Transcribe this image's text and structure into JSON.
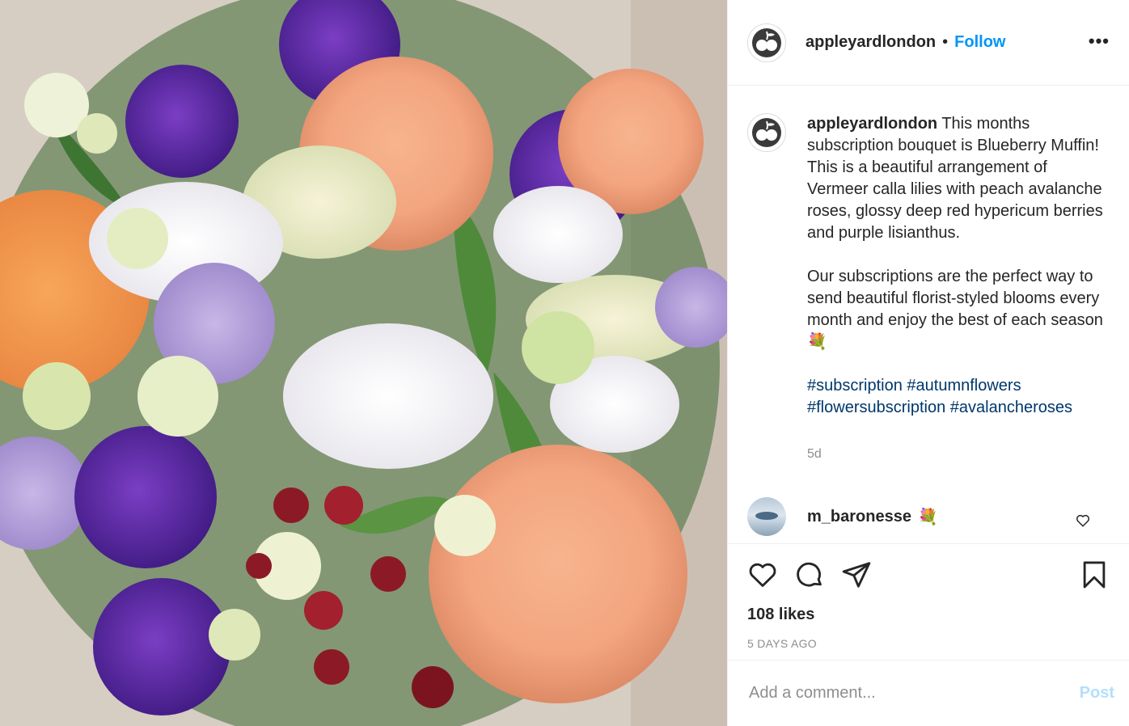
{
  "header": {
    "username": "appleyardlondon",
    "separator": "•",
    "follow_label": "Follow",
    "more_label": "•••"
  },
  "caption": {
    "username": "appleyardlondon",
    "text1": "This months subscription bouquet is Blueberry Muffin! This is a beautiful arrangement of Vermeer calla lilies with peach avalanche roses, glossy deep red hypericum berries and purple lisianthus.",
    "text2": "Our subscriptions are the perfect way to send beautiful florist-styled blooms every month and enjoy the best of each season",
    "text2_emoji": "💐",
    "hashtags": [
      "#subscription",
      "#autumnflowers",
      "#flowersubscription",
      "#avalancheroses"
    ],
    "age": "5d"
  },
  "comment": {
    "username": "m_baronesse",
    "emoji": "💐"
  },
  "actions": {
    "icons": [
      "heart-icon",
      "comment-icon",
      "share-icon",
      "bookmark-icon"
    ],
    "likes": "108 likes",
    "date": "5 DAYS AGO"
  },
  "add_comment": {
    "placeholder": "Add a comment...",
    "post_label": "Post"
  },
  "colors": {
    "link": "#0095f6",
    "hashtag": "#00376b",
    "muted": "#8e8e8e",
    "post_disabled": "#b2dffc"
  }
}
